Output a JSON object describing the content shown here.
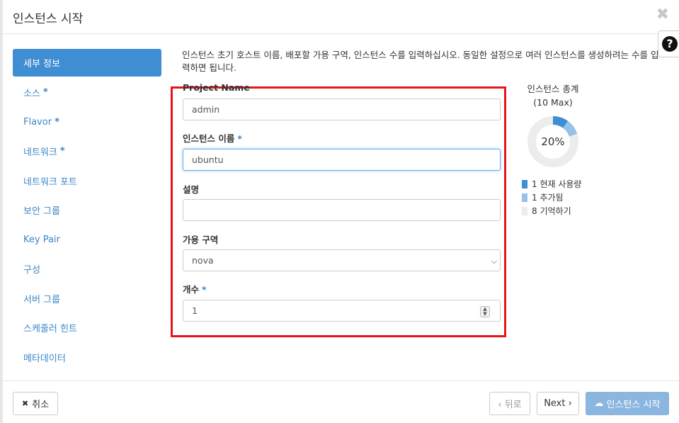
{
  "modal": {
    "title": "인스턴스 시작",
    "close_glyph": "✖",
    "help_glyph": "?"
  },
  "nav": {
    "items": [
      {
        "label": "세부 정보",
        "required": false,
        "active": true
      },
      {
        "label": "소스",
        "required": true,
        "active": false
      },
      {
        "label": "Flavor",
        "required": true,
        "active": false
      },
      {
        "label": "네트워크",
        "required": true,
        "active": false
      },
      {
        "label": "네트워크 포트",
        "required": false,
        "active": false
      },
      {
        "label": "보안 그룹",
        "required": false,
        "active": false
      },
      {
        "label": "Key Pair",
        "required": false,
        "active": false
      },
      {
        "label": "구성",
        "required": false,
        "active": false
      },
      {
        "label": "서버 그룹",
        "required": false,
        "active": false
      },
      {
        "label": "스케줄러 힌트",
        "required": false,
        "active": false
      },
      {
        "label": "메타데이터",
        "required": false,
        "active": false
      }
    ],
    "required_mark": "*"
  },
  "intro": "인스턴스 초기 호스트 이름, 배포할 가용 구역, 인스턴스 수를 입력하십시오. 동일한 설정으로 여러 인스턴스를 생성하려는 수를 입력하면 됩니다.",
  "form": {
    "project": {
      "label": "Project Name",
      "value": "admin"
    },
    "instance_name": {
      "label": "인스턴스 이름",
      "value": "ubuntu"
    },
    "description": {
      "label": "설명",
      "value": ""
    },
    "availability_zone": {
      "label": "가용 구역",
      "value": "nova"
    },
    "count": {
      "label": "개수",
      "value": "1"
    },
    "required_mark": "*"
  },
  "quota": {
    "title": "인스턴스 총계",
    "max": "(10 Max)",
    "percent_label": "20%",
    "current": 1,
    "added": 1,
    "remaining": 8,
    "legend": [
      {
        "text": "1 현재 사용량",
        "color": "#3f8dd2"
      },
      {
        "text": "1 추가됨",
        "color": "#97c1e6"
      },
      {
        "text": "8 기억하기",
        "color": "#ececec"
      }
    ]
  },
  "footer": {
    "cancel": "취소",
    "back": "‹ 뒤로",
    "next": "Next ›",
    "launch": "인스턴스 시작"
  },
  "colors": {
    "accent": "#3f8dd2",
    "highlight_box": "#e8141c"
  }
}
